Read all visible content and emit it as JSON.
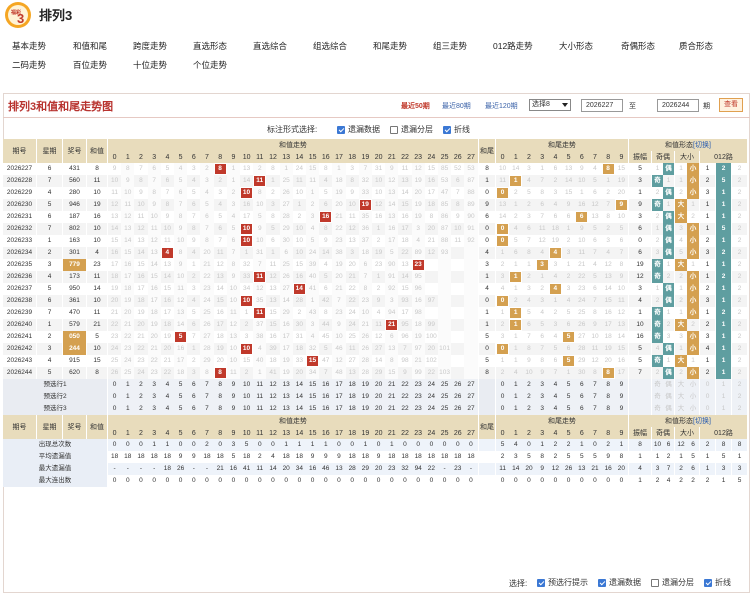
{
  "app": {
    "logo_text": "福彩3",
    "title": "排列3"
  },
  "nav": [
    "基本走势",
    "和值和尾",
    "跨度走势",
    "直选形态",
    "直选综合",
    "组选综合",
    "和尾走势",
    "组三走势",
    "012路走势",
    "大小形态",
    "奇偶形态",
    "质合形态",
    "二码走势",
    "百位走势",
    "十位走势",
    "个位走势"
  ],
  "chart_title": "排列3和值和尾走势图",
  "quick": [
    "最近50期",
    "最近80期",
    "最近120期"
  ],
  "select_value": "选择8",
  "range": {
    "from": "2026227",
    "sep": "至",
    "to": "2026244",
    "unit": "期"
  },
  "search_button": "查看",
  "display_label": "标注形式选择:",
  "display_opts": [
    {
      "label": "遗漏数据",
      "on": true
    },
    {
      "label": "遗漏分层",
      "on": false
    },
    {
      "label": "折线",
      "on": true
    }
  ],
  "headers": {
    "issue": "期号",
    "week": "星期",
    "prize": "奖号",
    "sum": "和值",
    "sum_trend": "和值走势",
    "tail": "和尾",
    "tail_trend": "和尾走势",
    "form": "和值形态",
    "switch": "[切换]",
    "amp": "振幅",
    "oddeven": "奇偶",
    "bigsmall": "大小",
    "road": "012路"
  },
  "rows": [
    {
      "issue": "2026227",
      "week": "6",
      "prize": "431",
      "sum": "8",
      "sums": "9 8 7 6 5 4 3 2 1 1 13 2 8 1 24 15 8 1 3 7 31 9 11 12 15 85 52 53",
      "tails": "10 14 3 1 6 13 9 4 8 15",
      "f": [
        "5",
        "1",
        "偶",
        "1",
        "小",
        "1",
        "2"
      ]
    },
    {
      "issue": "2026228",
      "week": "7",
      "prize": "560",
      "sum": "11",
      "sums": "10 9 8 7 6 5 4 3 2 1 14 5 1 25 11 11 4 18 8 32 10 12 13 19 16 53 6 87",
      "tails": "11 1 4 7 2 14 10 5 1 19",
      "f": [
        "3",
        "1",
        "奇",
        "1",
        "小",
        "2",
        "5"
      ]
    },
    {
      "issue": "2026229",
      "week": "4",
      "prize": "280",
      "sum": "10",
      "sums": "11 10 9 8 7 6 5 4 3 2 15 8 2 26 10 1 5 19 9 33 10 13 14 20 17 47 7 88",
      "tails": "12 2 5 8 3 15 1 6 2 20",
      "f": [
        "1",
        "2",
        "偶",
        "2",
        "小",
        "3",
        "1"
      ]
    },
    {
      "issue": "2026230",
      "week": "5",
      "prize": "946",
      "sum": "19",
      "sums": "12 11 10 9 8 7 6 5 4 3 16 10 3 27 1 2 6 20 10 34 12 14 15 19 18 85 8 89",
      "tails": "13 1 2 6 4 9 16 12 7 9",
      "f": [
        "9",
        "1",
        "奇",
        "1",
        "大",
        "1",
        "1"
      ]
    },
    {
      "issue": "2026231",
      "week": "6",
      "prize": "187",
      "sum": "16",
      "sums": "13 12 11 10 9 8 7 6 5 4 17 5 8 28 2 3 7 21 11 35 16 13 16 19 8 86 9 90",
      "tails": "14 2 3 7 6 6 17 13 8 10",
      "f": [
        "3",
        "2",
        "偶",
        "2",
        "大",
        "1",
        "1"
      ]
    },
    {
      "issue": "2026232",
      "week": "7",
      "prize": "802",
      "sum": "10",
      "sums": "14 13 12 11 10 9 8 7 6 5 18 9 5 29 10 4 8 22 12 36 1 16 17 3 20 87 10 91",
      "tails": "0 4 6 11 18 1 9 5 2 5",
      "f": [
        "6",
        "1",
        "偶",
        "3",
        "小",
        "1",
        "5"
      ]
    },
    {
      "issue": "2026233",
      "week": "1",
      "prize": "163",
      "sum": "10",
      "sums": "15 14 13 12 11 10 9 8 7 6 19 10 6 30 10 5 9 23 13 37 2 17 18 4 21 88 11 92",
      "tails": "0 5 7 12 19 2 10 6 3 6",
      "f": [
        "0",
        "2",
        "偶",
        "4",
        "小",
        "2",
        "1"
      ]
    },
    {
      "issue": "2026234",
      "week": "2",
      "prize": "301",
      "sum": "4",
      "sums": "16 15 14 13 12 8 4 20 11 7 1 31 1 6 10 24 14 38 3 18 19 5 22 89 12 93",
      "tails": "1 6 8 4 20 3 11 7 4 7",
      "f": [
        "6",
        "3",
        "偶",
        "5",
        "小",
        "3",
        "2"
      ]
    },
    {
      "issue": "2026235",
      "week": "3",
      "prize": "779",
      "sum": "23",
      "sums": "17 16 15 14 13 9 1 21 12 8 32 7 11 25 15 39 4 19 20 6 23 90 13 94",
      "tails": "2 1 1 1 3 1 21 4 12 8",
      "f": [
        "19",
        "1",
        "奇",
        "1",
        "大",
        "1",
        "1"
      ]
    },
    {
      "issue": "2026236",
      "week": "4",
      "prize": "173",
      "sum": "11",
      "sums": "18 17 16 15 14 10 2 22 13 9 33 11 12 26 16 40 5 20 21 7 1 91 14 95",
      "tails": "3 1 2 1 4 2 22 5 13 9",
      "f": [
        "12",
        "2",
        "奇",
        "2",
        "小",
        "1",
        "2"
      ]
    },
    {
      "issue": "2026237",
      "week": "5",
      "prize": "950",
      "sum": "14",
      "sums": "19 18 17 16 15 11 3 23 14 10 34 12 13 27 14 41 6 21 22 8 2 92 15 96",
      "tails": "4 1 3 2 4 3 23 6 14 10",
      "f": [
        "3",
        "1",
        "偶",
        "1",
        "小",
        "2",
        "1"
      ]
    },
    {
      "issue": "2026238",
      "week": "6",
      "prize": "361",
      "sum": "10",
      "sums": "20 19 18 17 16 12 4 24 15 10 1 35 13 14 28 1 42 7 22 23 9 3 93 16 97",
      "tails": "0 2 4 3 1 4 24 7 15 11",
      "f": [
        "4",
        "2",
        "偶",
        "2",
        "小",
        "3",
        "1"
      ]
    },
    {
      "issue": "2026239",
      "week": "7",
      "prize": "470",
      "sum": "11",
      "sums": "21 20 19 18 17 13 5 25 16 11 1 14 15 29 2 43 8 23 24 10 4 94 17 98",
      "tails": "1 1 5 4 2 5 25 8 16 12",
      "f": [
        "1",
        "1",
        "奇",
        "1",
        "小",
        "1",
        "2"
      ]
    },
    {
      "issue": "2026240",
      "week": "1",
      "prize": "579",
      "sum": "21",
      "sums": "22 21 20 19 18 14 6 26 17 12 2 37 15 16 30 3 44 9 24 21 11 5 95 18 99",
      "tails": "2 1 6 5 3 6 26 9 17 13",
      "f": [
        "10",
        "2",
        "奇",
        "2",
        "大",
        "2",
        "1"
      ]
    },
    {
      "issue": "2026241",
      "week": "2",
      "prize": "050",
      "sum": "5",
      "sums": "23 22 21 20 19 15 7 27 18 13 3 38 16 17 31 4 45 10 25 26 12 6 96 19 100",
      "tails": "3 1 7 6 4 5 27 10 18 14",
      "f": [
        "16",
        "3",
        "奇",
        "3",
        "小",
        "3",
        "1"
      ]
    },
    {
      "issue": "2026242",
      "week": "3",
      "prize": "244",
      "sum": "10",
      "sums": "24 23 22 21 20 16 1 28 19 10 1 4 39 17 18 32 5 46 11 26 27 13 7 97 20 101",
      "tails": "0 1 8 7 5 6 28 11 19 15",
      "f": [
        "5",
        "4",
        "偶",
        "1",
        "小",
        "4",
        "1"
      ]
    },
    {
      "issue": "2026243",
      "week": "4",
      "prize": "915",
      "sum": "15",
      "sums": "25 24 23 22 21 17 2 29 20 10 15 40 18 19 33 6 47 12 27 28 14 8 98 21 102",
      "tails": "1 1 9 8 6 5 29 12 20 16",
      "f": [
        "5",
        "1",
        "奇",
        "1",
        "大",
        "1",
        "1"
      ]
    },
    {
      "issue": "2026244",
      "week": "5",
      "prize": "620",
      "sum": "8",
      "sums": "26 25 24 23 22 18 3 8 21 11 2 1 41 19 20 34 7 48 13 28 29 15 9 99 22 103",
      "tails": "2 4 10 9 7 1 30 8 21 17",
      "f": [
        "7",
        "2",
        "偶",
        "2",
        "小",
        "2",
        "1"
      ]
    }
  ],
  "preview_labels": [
    "预选行1",
    "预选行2",
    "预选行3"
  ],
  "preview_extra": [
    "奇",
    "偶",
    "大",
    "小",
    "0",
    "1",
    "2"
  ],
  "stats": [
    {
      "label": "出现总次数",
      "sums": "0 0 0 1 1 0 0 2 0 3 5 0 0 1 1 1 1 0 0 1 0 1 0 0 0 0 0 0 0",
      "tails": "5 4 0 1 2 2 1 0 2 1",
      "f": [
        "",
        "8 10 6",
        "",
        "12 6",
        "",
        "2 8 8"
      ]
    },
    {
      "label": "平均遗漏值",
      "sums": "18 18 18 18 18 9 9 18 18 5 18 2 4 18 18 9 9 9 18 18 9 18 18 18 18 18 18 18",
      "tails": "2 3 5 8 2 5 5 5 9 8",
      "f": [
        "",
        "1 1 2",
        "",
        "1 5",
        "",
        "1 5 1"
      ]
    },
    {
      "label": "最大遗漏值",
      "sums": "- - - - 18 26 - - 21 16 41 11 14 20 34 16 46 13 28 29 20 23 32 94 22 - 23 - -",
      "tails": "11 14 20 9 12 26 13 21 16 20",
      "f": [
        "",
        "4 3 7",
        "",
        "2 6",
        "",
        "1 3 3"
      ]
    },
    {
      "label": "最大连出数",
      "sums": "0 0 0 0 0 0 0 0 0 0 0 0 0 0 0 0 0 0 0 0 0 0 0 0 0 0 0 0",
      "tails": "0 0 0 0 0 0 0 0 0 0",
      "f": [
        "",
        "1 2 4",
        "",
        "2 2",
        "",
        "2 1 5"
      ]
    }
  ],
  "footer": {
    "label": "选择:",
    "opts": [
      {
        "label": "预选行提示",
        "on": true
      },
      {
        "label": "遗漏数据",
        "on": true
      },
      {
        "label": "遗漏分层",
        "on": false
      },
      {
        "label": "折线",
        "on": true
      }
    ]
  },
  "colors": {
    "sum_hit": "#c0392b",
    "tail_hit": "#d4a050",
    "form_a": "#5f9ea0",
    "form_b": "#d4a050",
    "prize_hl": "#d4a050"
  }
}
